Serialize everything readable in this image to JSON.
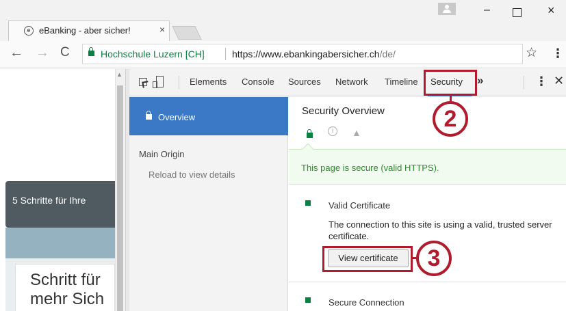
{
  "browser": {
    "tab_title": "eBanking - aber sicher!",
    "tab_close": "×",
    "window_min": "–",
    "window_close": "×",
    "back": "←",
    "forward": "→",
    "reload": "C",
    "ev_name": "Hochschule Luzern [CH]",
    "url_origin": "https://www.ebankingabersicher.ch",
    "url_path": "/de/",
    "star": "☆",
    "menu": "⋮"
  },
  "page": {
    "banner_text": "5 Schritte für Ihre",
    "heading_line1": "Schritt für",
    "heading_line2": "mehr Sich"
  },
  "devtools": {
    "tabs": [
      "Elements",
      "Console",
      "Sources",
      "Network",
      "Timeline",
      "Security"
    ],
    "more": "»",
    "kebab": "⋮",
    "close": "✕",
    "active_tab": "Security"
  },
  "security": {
    "sidebar": {
      "overview": "Overview",
      "main_origin": "Main Origin",
      "reload_details": "Reload to view details"
    },
    "title": "Security Overview",
    "info_icon": "i",
    "warn_icon": "▲",
    "summary": "This page is secure (valid HTTPS).",
    "certificate": {
      "title": "Valid Certificate",
      "description": "The connection to this site is using a valid, trusted server certificate.",
      "button": "View certificate"
    },
    "connection": {
      "title": "Secure Connection"
    }
  },
  "annotations": {
    "step2": "2",
    "step3": "3",
    "color": "#b01c2e"
  },
  "colors": {
    "accent": "#3b78c5",
    "secure_green": "#0b8043"
  }
}
